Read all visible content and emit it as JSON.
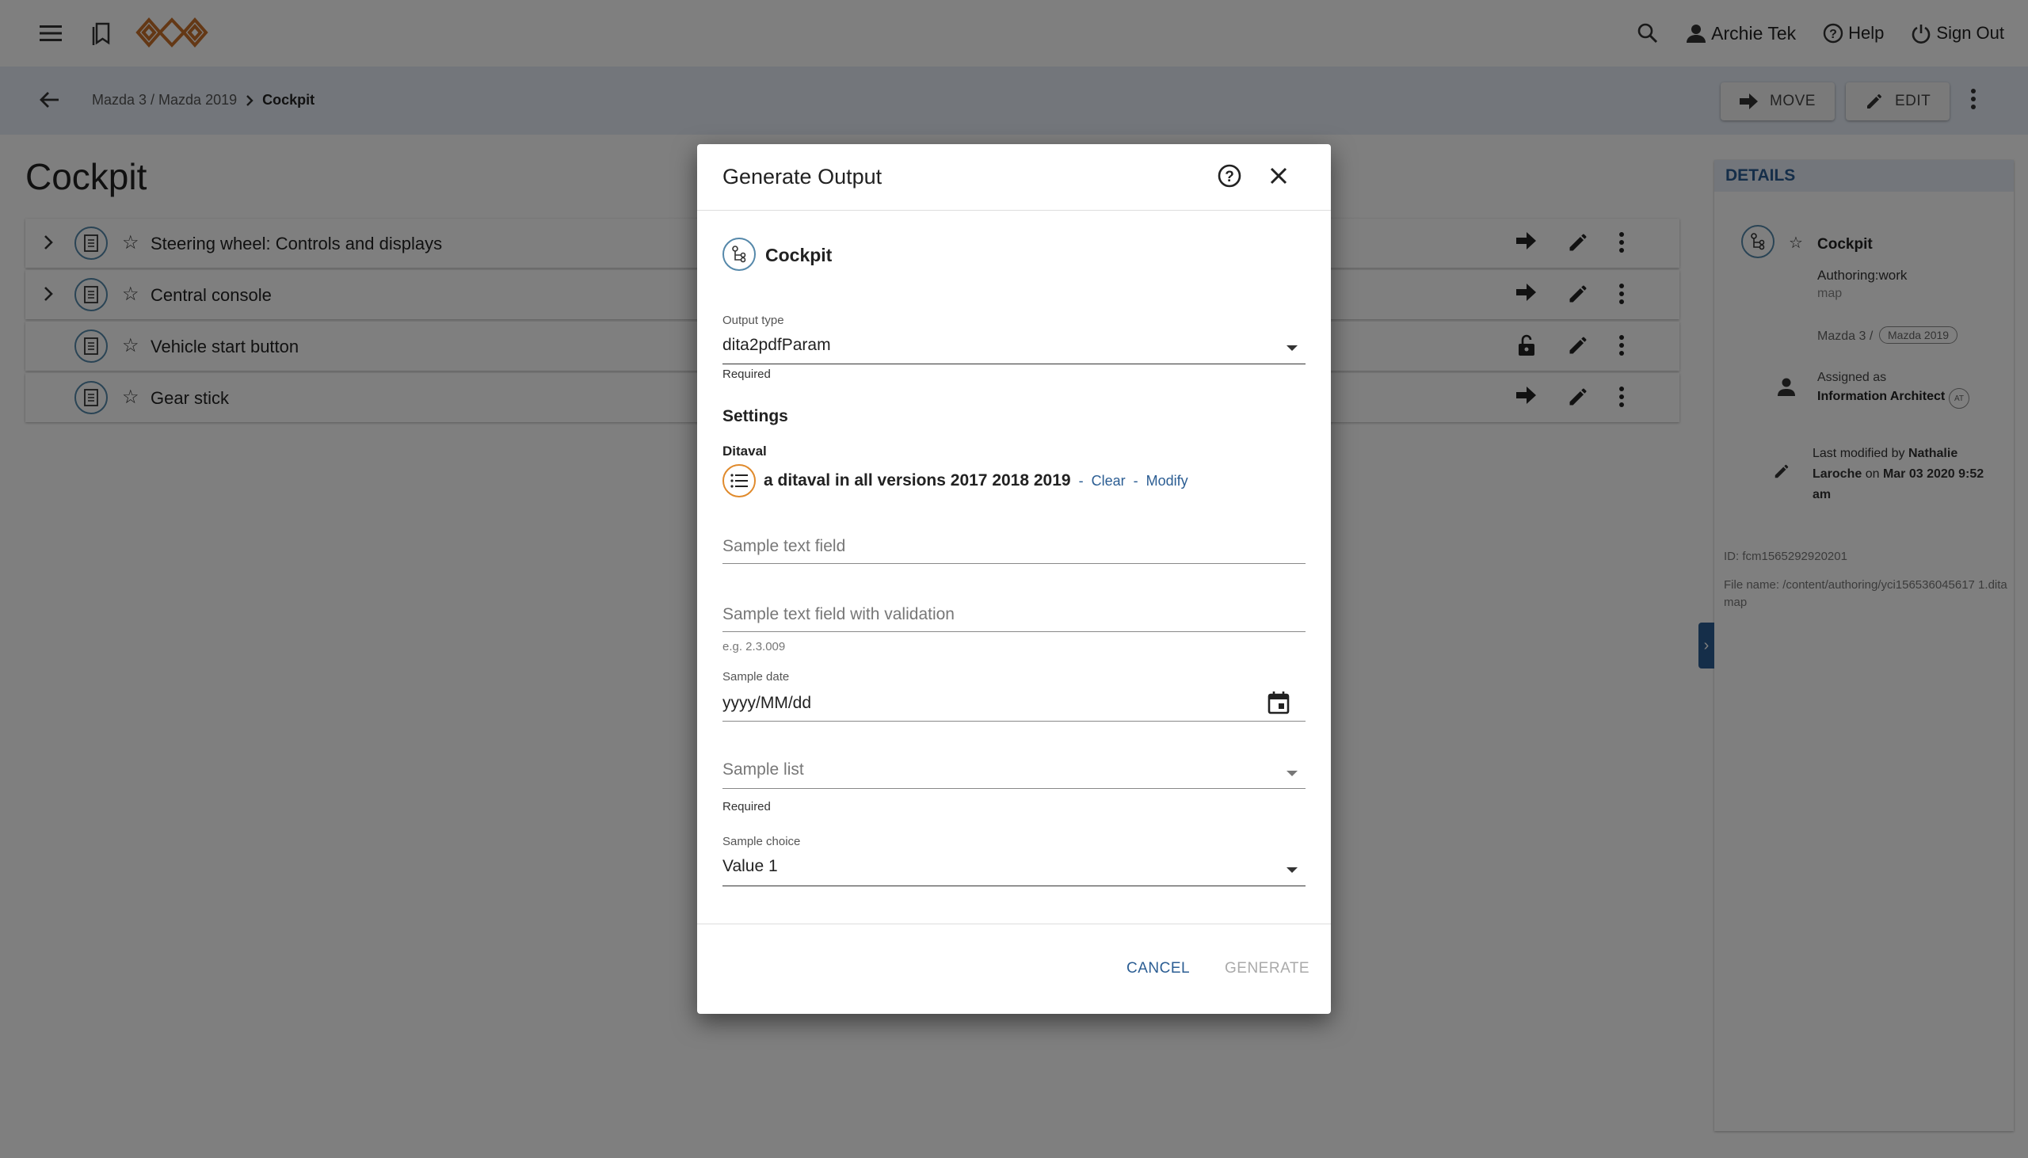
{
  "topbar": {
    "user": "Archie Tek",
    "help": "Help",
    "sign_out": "Sign Out"
  },
  "breadcrumb": {
    "path": "Mazda 3 / Mazda 2019",
    "current": "Cockpit"
  },
  "actions": {
    "move": "MOVE",
    "edit": "EDIT"
  },
  "page_title": "Cockpit",
  "rows": [
    {
      "title": "Steering wheel: Controls and displays",
      "expandable": true
    },
    {
      "title": "Central console",
      "expandable": true
    },
    {
      "title": "Vehicle start button",
      "expandable": false,
      "locked": true
    },
    {
      "title": "Gear stick",
      "expandable": false
    }
  ],
  "details": {
    "header": "DETAILS",
    "name": "Cockpit",
    "status": "Authoring:work",
    "type": "map",
    "path": "Mazda 3 /",
    "version_chip": "Mazda 2019",
    "assigned_label": "Assigned as",
    "assigned_role": "Information Architect",
    "role_badge": "AT",
    "modified_prefix": "Last modified by",
    "modified_by": "Nathalie Laroche",
    "modified_on": "on",
    "modified_date": "Mar 03 2020 9:52 am",
    "id": "ID: fcm1565292920201",
    "file_name": "File name: /content/authoring/yci156536045617 1.ditamap"
  },
  "dialog": {
    "title": "Generate Output",
    "map_name": "Cockpit",
    "output_type_label": "Output type",
    "output_type_value": "dita2pdfParam",
    "output_type_hint": "Required",
    "settings_title": "Settings",
    "ditaval_label": "Ditaval",
    "ditaval_name": "a ditaval in all versions 2017 2018 2019",
    "ditaval_sep": "-",
    "ditaval_clear": "Clear",
    "ditaval_modify": "Modify",
    "text_field_placeholder": "Sample text field",
    "validation_field_placeholder": "Sample text field with validation",
    "validation_hint": "e.g. 2.3.009",
    "date_label": "Sample date",
    "date_value": "yyyy/MM/dd",
    "list_placeholder": "Sample list",
    "list_hint": "Required",
    "choice_label": "Sample choice",
    "choice_value": "Value 1",
    "cancel": "CANCEL",
    "generate": "GENERATE"
  },
  "colors": {
    "accent": "#2b5d93",
    "ditaval_ring": "#e08a2c",
    "subbar": "#e6edf7",
    "logo": "#c8702a"
  }
}
